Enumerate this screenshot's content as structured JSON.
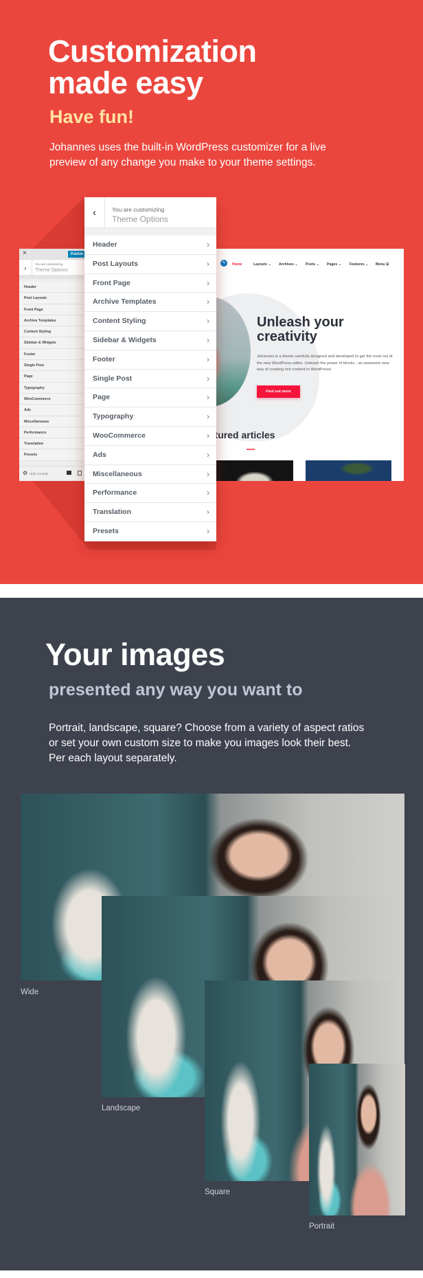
{
  "colors": {
    "red_bg": "#eb463e",
    "dark_bg": "#3e424d",
    "accent_yellow": "#ffe3a0",
    "subtitle_gray": "#c1c6d6",
    "wp_blue": "#0085ba",
    "site_red": "#f5143c"
  },
  "section1": {
    "title_line1": "Customization",
    "title_line2": "made easy",
    "subtitle": "Have fun!",
    "paragraph": "Johannes uses the built-in WordPress customizer for a live preview of any change you make to your theme settings."
  },
  "customizer": {
    "close_icon": "×",
    "publish_label": "Publish",
    "back_icon": "‹",
    "customizing_label": "You are customizing",
    "section_title": "Theme Options",
    "items": [
      "Header",
      "Post Layouts",
      "Front Page",
      "Archive Templates",
      "Content Styling",
      "Sidebar & Widgets",
      "Footer",
      "Single Post",
      "Page",
      "Typography",
      "WooCommerce",
      "Ads",
      "Miscellaneous",
      "Performance",
      "Translation",
      "Presets"
    ],
    "chevron_icon": "›",
    "hide_controls_label": "Hide Controls",
    "gear_icon": "⚙"
  },
  "site_preview": {
    "nav": [
      "Home",
      "Layouts ⌄",
      "Archives ⌄",
      "Posts ⌄",
      "Pages ⌄",
      "Features ⌄",
      "Menu ☰"
    ],
    "hero_title": "Unleash your creativity",
    "hero_text": "Johannes is a theme carefully designed and developed to get the most out of the new WordPress editor. Unleash the power of blocks - an awesome new way of creating rich content in WordPress!",
    "hero_button": "Find out more",
    "featured_heading": "eatured articles"
  },
  "section2": {
    "title": "Your images",
    "subtitle": "presented any way you want to",
    "paragraph": "Portrait, landscape, square? Choose from a variety of aspect ratios or set your own custom size to make you images look their best. Per each layout separately.",
    "image_labels": {
      "wide": "Wide",
      "landscape": "Landscape",
      "square": "Square",
      "portrait": "Portrait"
    }
  }
}
